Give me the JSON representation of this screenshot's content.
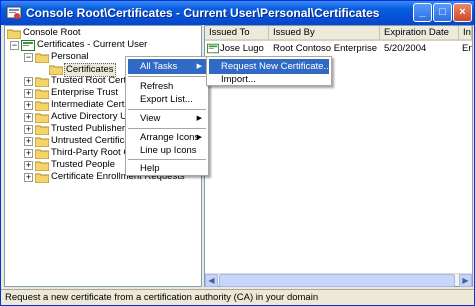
{
  "window": {
    "title": "Console Root\\Certificates - Current User\\Personal\\Certificates",
    "minimize_glyph": "_",
    "maximize_glyph": "□",
    "close_glyph": "×"
  },
  "tree": {
    "items": [
      {
        "label": "Console Root"
      },
      {
        "label": "Certificates - Current User"
      },
      {
        "label": "Personal"
      },
      {
        "label": "Certificates"
      },
      {
        "label": "Trusted Root Certification Authorities"
      },
      {
        "label": "Enterprise Trust"
      },
      {
        "label": "Intermediate Certification Authorities"
      },
      {
        "label": "Active Directory User Object"
      },
      {
        "label": "Trusted Publishers"
      },
      {
        "label": "Untrusted Certificates"
      },
      {
        "label": "Third-Party Root Certification Authorities"
      },
      {
        "label": "Trusted People"
      },
      {
        "label": "Certificate Enrollment Requests"
      }
    ]
  },
  "list": {
    "columns": [
      "Issued To",
      "Issued By",
      "Expiration Date",
      "Intended Purposes"
    ],
    "rows": [
      {
        "issued_to": "Jose Lugo",
        "issued_by": "Root Contoso Enterprise CA",
        "expiration": "5/20/2004",
        "purpose": "En"
      }
    ]
  },
  "context_menu": {
    "all_tasks": "All Tasks",
    "refresh": "Refresh",
    "export_list": "Export List...",
    "view": "View",
    "arrange_icons": "Arrange Icons",
    "line_up_icons": "Line up Icons",
    "help": "Help"
  },
  "submenu": {
    "request_new": "Request New Certificate...",
    "import": "Import..."
  },
  "statusbar": {
    "text": "Request a new certificate from a certification authority (CA) in your domain"
  },
  "colors": {
    "title_blue": "#0550d8",
    "menu_highlight": "#316ac5",
    "folder_yellow": "#f4d36a"
  },
  "icons": {
    "app": "certificate-console-icon",
    "folder": "folder-icon",
    "certificate": "certificate-icon"
  }
}
